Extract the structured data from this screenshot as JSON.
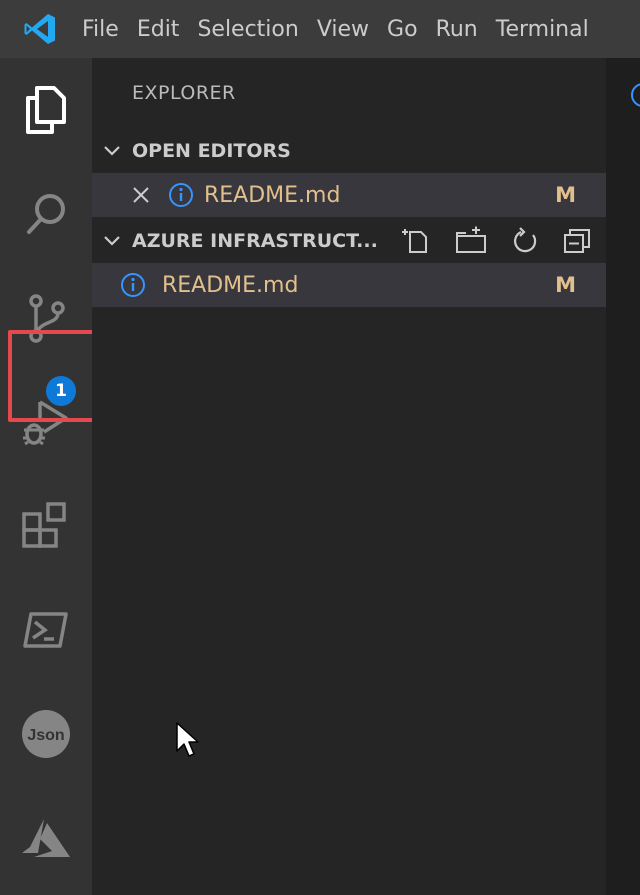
{
  "menu": {
    "items": [
      "File",
      "Edit",
      "Selection",
      "View",
      "Go",
      "Run",
      "Terminal"
    ]
  },
  "activity_bar": {
    "items": [
      {
        "icon": "files-icon",
        "active": true
      },
      {
        "icon": "search-icon"
      },
      {
        "icon": "source-control-icon",
        "badge": "1",
        "highlighted": true
      },
      {
        "icon": "run-debug-icon"
      },
      {
        "icon": "extensions-icon"
      },
      {
        "icon": "powershell-icon"
      },
      {
        "icon": "json-icon",
        "label": "Json"
      },
      {
        "icon": "azure-icon"
      }
    ]
  },
  "explorer": {
    "title": "EXPLORER",
    "open_editors": {
      "header": "OPEN EDITORS",
      "items": [
        {
          "name": "README.md",
          "status": "M"
        }
      ]
    },
    "workspace": {
      "header": "AZURE INFRASTRUCT...",
      "items": [
        {
          "name": "README.md",
          "status": "M"
        }
      ]
    }
  },
  "colors": {
    "accent": "#0e79d6",
    "highlight": "#e5484d",
    "modified": "#e2c08d",
    "info": "#3794ff"
  }
}
